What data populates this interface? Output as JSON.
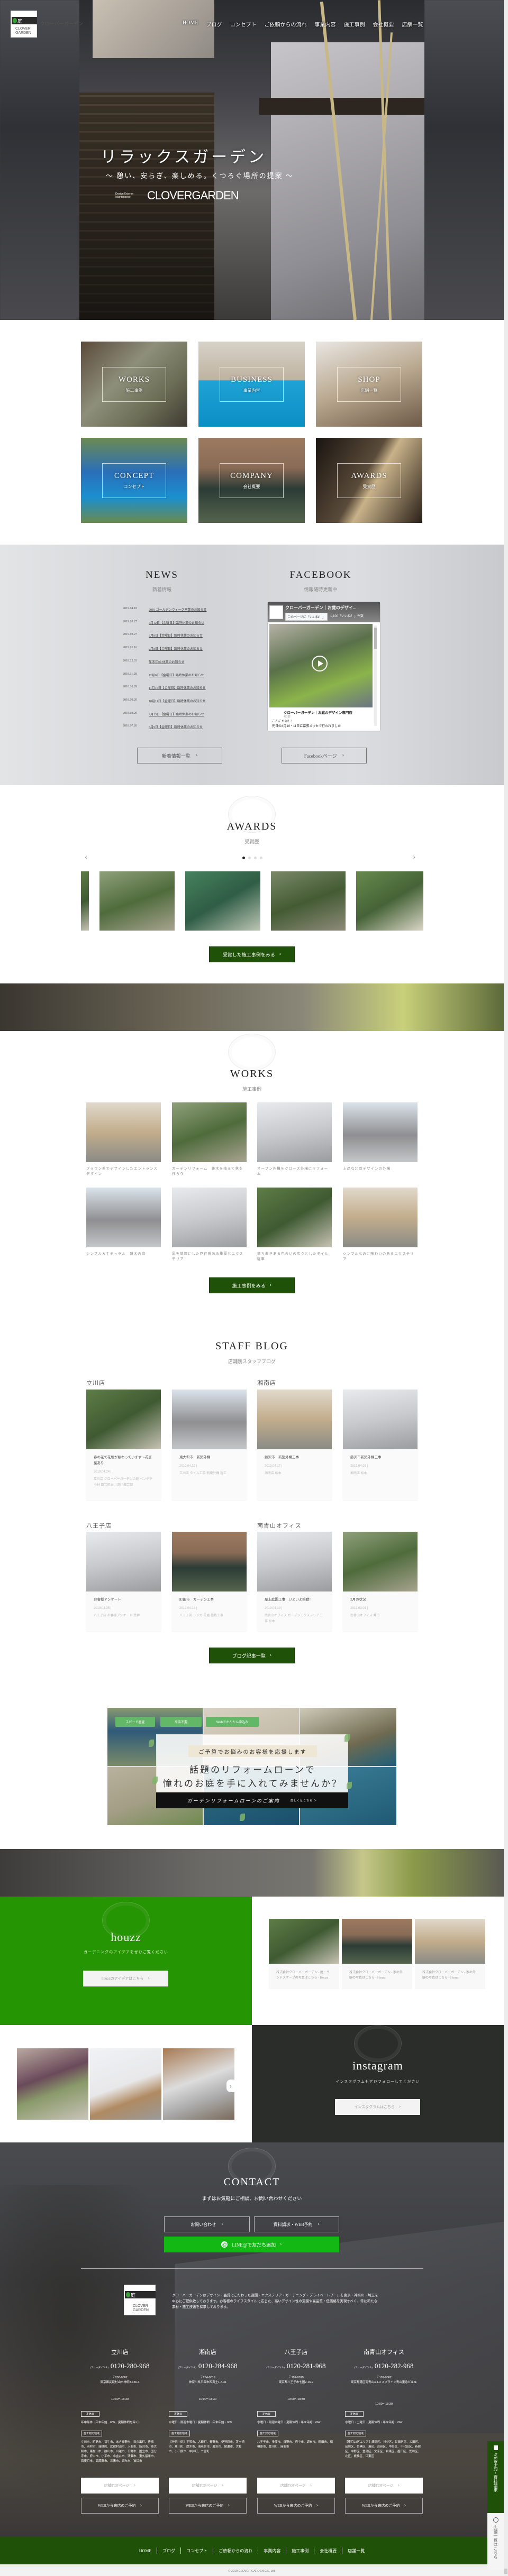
{
  "colors": {
    "brand_green": "#1f5208",
    "houzz_green": "#269503",
    "line_green": "#14b814",
    "instagram_bg": "#2a2d2a"
  },
  "header": {
    "logo_text": "庭",
    "logo_brand": "CLOVER GARDEN",
    "logo_name": "クローバーガーデン",
    "nav": [
      "HOME",
      "ブログ",
      "コンセプト",
      "ご依頼からの流れ",
      "事業内容",
      "施工事例",
      "会社概要",
      "店舗一覧"
    ]
  },
  "hero": {
    "title": "リラックスガーデン",
    "subtitle": "〜 憩い、安らぎ、楽しめる。くつろぐ場所の提案 〜",
    "brand_small": "Design Exterior Maintenance",
    "brand": "CLOVERGARDEN"
  },
  "tiles": [
    {
      "en": "WORKS",
      "ja": "施工事例"
    },
    {
      "en": "BUSINESS",
      "ja": "事業内容"
    },
    {
      "en": "SHOP",
      "ja": "店舗一覧"
    },
    {
      "en": "CONCEPT",
      "ja": "コンセプト"
    },
    {
      "en": "COMPANY",
      "ja": "会社概要"
    },
    {
      "en": "AWARDS",
      "ja": "受賞歴"
    }
  ],
  "news": {
    "title": "NEWS",
    "subtitle": "新着情報",
    "button": "新着情報一覧",
    "items": [
      {
        "date": "2019.04.18",
        "title": "2019 ゴールデンウィーク営業のお知らせ"
      },
      {
        "date": "2019.03.27",
        "title": "4月12日【金曜日】臨時休業のお知らせ"
      },
      {
        "date": "2019.02.27",
        "title": "3月8日【金曜日】臨時休業のお知らせ"
      },
      {
        "date": "2019.01.16",
        "title": "2月8日【金曜日】臨時休業のお知らせ"
      },
      {
        "date": "2018.12.03",
        "title": "年末年始 休業のお知らせ"
      },
      {
        "date": "2018.11.28",
        "title": "12月6日【金曜日】臨時休業のお知らせ"
      },
      {
        "date": "2018.10.29",
        "title": "11月15日【金曜日】臨時休業のお知らせ"
      },
      {
        "date": "2018.09.20",
        "title": "10月11日【金曜日】臨時休業のお知らせ"
      },
      {
        "date": "2018.08.20",
        "title": "9月13日【金曜日】臨時休業のお知らせ"
      },
      {
        "date": "2018.07.26",
        "title": "8月9日【金曜日】臨時休業のお知らせ"
      }
    ]
  },
  "facebook": {
    "title": "FACEBOOK",
    "subtitle": "情報随時更新中",
    "button": "Facebookページ",
    "page_name": "クローバーガーデン｜お庭のデザイ...",
    "like_button": "このページに「いいね！」",
    "likes": "1,100「いいね！」件数",
    "post_author": "クローバーガーデン｜お庭のデザイン専門店",
    "post_time": "4日前",
    "post_text_1": "こんにちは！！",
    "post_text_2": "先日の4月10・11日に幕張メッセで行われました"
  },
  "awards": {
    "title": "AWARDS",
    "subtitle": "受賞歴",
    "button": "受賞した施工事例をみる",
    "slide_count": 4,
    "active_slide": 1
  },
  "works": {
    "title": "WORKS",
    "subtitle": "施工事例",
    "button": "施工事例をみる",
    "items": [
      "ブラウン系でデザインしたエントランスデザイン",
      "ガーデンリフォーム　雑木を植えて林を作ろう",
      "オープン外構をクローズ外構にリフォーム",
      "上品な北欧デザインの外構",
      "シンプル＆ナチュラル　雑木の庭",
      "黒を基調にした存在感ある重厚なエクステリア",
      "落ち着きある色合いの広々としたタイル駐車",
      "シンプルなのに味わいのあるエクステリア"
    ]
  },
  "blog": {
    "title": "STAFF BLOG",
    "subtitle": "店舗別スタッフブログ",
    "button": "ブログ記事一覧",
    "stores": [
      "立川店",
      "湘南店",
      "八王子店",
      "南青山オフィス"
    ],
    "posts": [
      {
        "title": "春の花で花壇が賑わっています～花言葉あり",
        "date": "2019.04.24 |",
        "meta": "立川店 クローバーガーデンの庭 ペンデチ 小林 園芸担当 川越 / 園芸部"
      },
      {
        "title": "東大和市　新築外構",
        "date": "2019.04.22 |",
        "meta": "立川店 タイル工事 新築外構 施工"
      },
      {
        "title": "藤沢市　新築外構工事",
        "date": "2019.04.17 |",
        "meta": "湘南店 松本"
      },
      {
        "title": "藤沢市新築外構工事",
        "date": "2019.04.03 |",
        "meta": "湘南店 松本"
      },
      {
        "title": "お客様アンケート",
        "date": "2019.04.25 |",
        "meta": "八王子店 お客様アンケート 荒井"
      },
      {
        "title": "町田市　ガーデン工事",
        "date": "2019.04.18 |",
        "meta": "八王子店 レンガ 花壇 植栽工事"
      },
      {
        "title": "屋上庭園工事　いよいよ始動！",
        "date": "2019.04.19 |",
        "meta": "南青山オフィス ガーデンエクステリア工事 松本"
      },
      {
        "title": "2月の状況",
        "date": "2019.03.01 |",
        "meta": "南青山オフィス 井出"
      }
    ]
  },
  "loan": {
    "tags": [
      "スピード審査",
      "来店不要",
      "Webでかんたん申込み"
    ],
    "lead": "ご予算でお悩みのお客様を応援します",
    "line1": "話題のリフォームローンで",
    "line2": "憧れのお庭を手に入れてみませんか？",
    "cta": "ガーデンリフォームローンのご案内",
    "cta_more": "詳しくはこちら ＞"
  },
  "houzz": {
    "title": "houzz",
    "subtitle": "ガーデニングのアイデアをぜひご覧ください",
    "button": "houzzのアイデアはこちら",
    "cards": [
      "株式会社クローバーガーデン - 庭・ランドスケープの写真はこちら - Houzz",
      "株式会社クローバーガーデン - 家の外観の写真はこちら - Houzz",
      "株式会社クローバーガーデン - 家の外観の写真はこちら - Houzz"
    ]
  },
  "instagram": {
    "title": "instagram",
    "subtitle": "インスタグラムもぜひフォローしてください",
    "button": "インスタグラムはこちら"
  },
  "contact": {
    "title": "CONTACT",
    "subtitle": "まずはお気軽にご相談、お問い合わせください",
    "inquiry": "お問い合わせ",
    "request": "資料請求・WEB予約",
    "line": "LINE@で友だち追加",
    "description": "クローバーガーデンはデザイン・品質にこだわった造園・エクステリア・ガーデニング・プライベートプールを東京・神奈川・埼玉を中心にご提供致しております。お客様のライフスタイルに応じた、高いデザイン性の造園や高品質・低価格を実現すべく、常に新たな素材・施工技術を探求しております。",
    "free_dial": "(フリーダイヤル)",
    "holiday_label": "定休日",
    "area_label": "施工対応地域",
    "store_top": "店舗TOPページ",
    "web_reserve": "WEBから来店のご予約",
    "stores": [
      {
        "name": "立川店",
        "tel": "0120-280-968",
        "zip": "〒208-0002",
        "address": "東京都武蔵村山市神明3-136-3",
        "hours": "10:00～18:30",
        "holiday": "年中無休（年末年始、GW、夏期休暇を除く）",
        "area": "立川市、昭島市、福生市、あきる野市、日の出町、青梅市、羽村市、瑞穂町、武蔵村山市、入間市、所沢市、東大和市、東村山市、狭山市、川越市、日野市、国立市、国分寺市、府中市、小平市、小金井市、清瀬市、東久留米市、西東京市、武蔵野市、三鷹市、調布市、狛江市"
      },
      {
        "name": "湘南店",
        "tel": "0120-284-968",
        "zip": "〒254-0019",
        "address": "神奈川県平塚市西真土1-3-41",
        "hours": "10:00～18:30",
        "holiday": "水曜日・隔週木曜日・夏期休暇・年末年始・GW",
        "area": "【神奈川県】平塚市、大磯町、秦野市、伊勢原市、茅ヶ崎市、寒川町、厚木市、海老名市、藤沢市、綾瀬市、大和市、小田原市、中井町、二宮町"
      },
      {
        "name": "八王子店",
        "tel": "0120-281-968",
        "zip": "〒192-0919",
        "address": "東京都八王子市七国2-16-2",
        "hours": "10:00～18:30",
        "holiday": "水曜日・隔週木曜日・夏期休暇・年末年始・GW",
        "area": "八王子市、多摩市、日野市、府中市、調布市、町田市、相模原市、愛川町、座間市"
      },
      {
        "name": "南青山オフィス",
        "tel": "0120-282-968",
        "zip": "〒107-0062",
        "address": "東京都港区南青山3-1-3 スプライン青山東急ビル6F",
        "hours": "10:00～18:30",
        "holiday": "水曜日・土曜日・夏期休暇・年末年始・GW",
        "area": "【東京23区エリア】練馬区、杉並区、世田谷区、大田区、品川区、目黒区、港区、渋谷区、中央区、千代田区、新宿区、中野区、豊島区、文京区、台東区、墨田区、荒川区、北区、板橋区、江東区"
      }
    ]
  },
  "footer": {
    "nav": [
      "HOME",
      "ブログ",
      "コンセプト",
      "ご依頼からの流れ",
      "事業内容",
      "施工事例",
      "会社概要",
      "店舗一覧"
    ],
    "copyright": "© 2019 CLOVER GARDEN Co., Ltd."
  },
  "side_tabs": {
    "web": "WEB予約・資料請求",
    "stores": "店舗一覧はこちら"
  },
  "icons": {
    "chevron": "chevron-right-icon",
    "play": "play-icon",
    "compass": "compass-icon",
    "document": "document-icon",
    "line": "line-at-icon",
    "facebook": "facebook-icon"
  }
}
